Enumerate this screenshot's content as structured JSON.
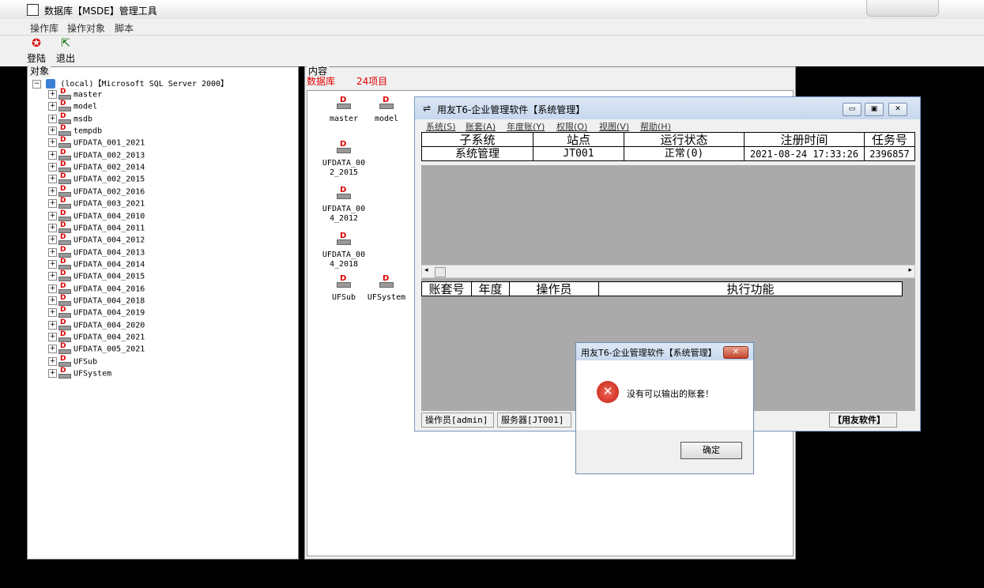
{
  "window": {
    "title": "数据库【MSDE】管理工具"
  },
  "menu": [
    "操作库",
    "操作对象",
    "脚本"
  ],
  "toolbar": {
    "login_label": "登陆",
    "exit_label": "退出"
  },
  "left_panel": {
    "label": "对象",
    "root": "(local)【Microsoft SQL Server  2000】",
    "items": [
      "master",
      "model",
      "msdb",
      "tempdb",
      "UFDATA_001_2021",
      "UFDATA_002_2013",
      "UFDATA_002_2014",
      "UFDATA_002_2015",
      "UFDATA_002_2016",
      "UFDATA_003_2021",
      "UFDATA_004_2010",
      "UFDATA_004_2011",
      "UFDATA_004_2012",
      "UFDATA_004_2013",
      "UFDATA_004_2014",
      "UFDATA_004_2015",
      "UFDATA_004_2016",
      "UFDATA_004_2018",
      "UFDATA_004_2019",
      "UFDATA_004_2020",
      "UFDATA_004_2021",
      "UFDATA_005_2021",
      "UFSub",
      "UFSystem"
    ]
  },
  "right_panel": {
    "label": "内容",
    "db_label": "数据库",
    "count": "24项目",
    "icons": [
      "master",
      "model",
      "UFDATA_00\n2_2015",
      "UFDATA_00\n4_2012",
      "UFDATA_00\n4_2018",
      "UFSub",
      "UFSystem"
    ]
  },
  "t6": {
    "title": "用友T6-企业管理软件【系统管理】",
    "menu": [
      "系统(S)",
      "账套(A)",
      "年度账(Y)",
      "权限(O)",
      "视图(V)",
      "帮助(H)"
    ],
    "grid1": {
      "headers": [
        "子系统",
        "站点",
        "运行状态",
        "注册时间",
        "任务号"
      ],
      "row": [
        "系统管理",
        "JT001",
        "正常(0)",
        "2021-08-24 17:33:26",
        "2396857"
      ]
    },
    "grid2": {
      "headers": [
        "账套号",
        "年度",
        "操作员",
        "执行功能"
      ]
    },
    "status": [
      "操作员[admin]",
      "服务器[JT001]",
      "【用友软件】"
    ]
  },
  "dialog": {
    "title": "用友T6-企业管理软件【系统管理】",
    "message": "没有可以输出的账套！",
    "ok_label": "确定"
  }
}
